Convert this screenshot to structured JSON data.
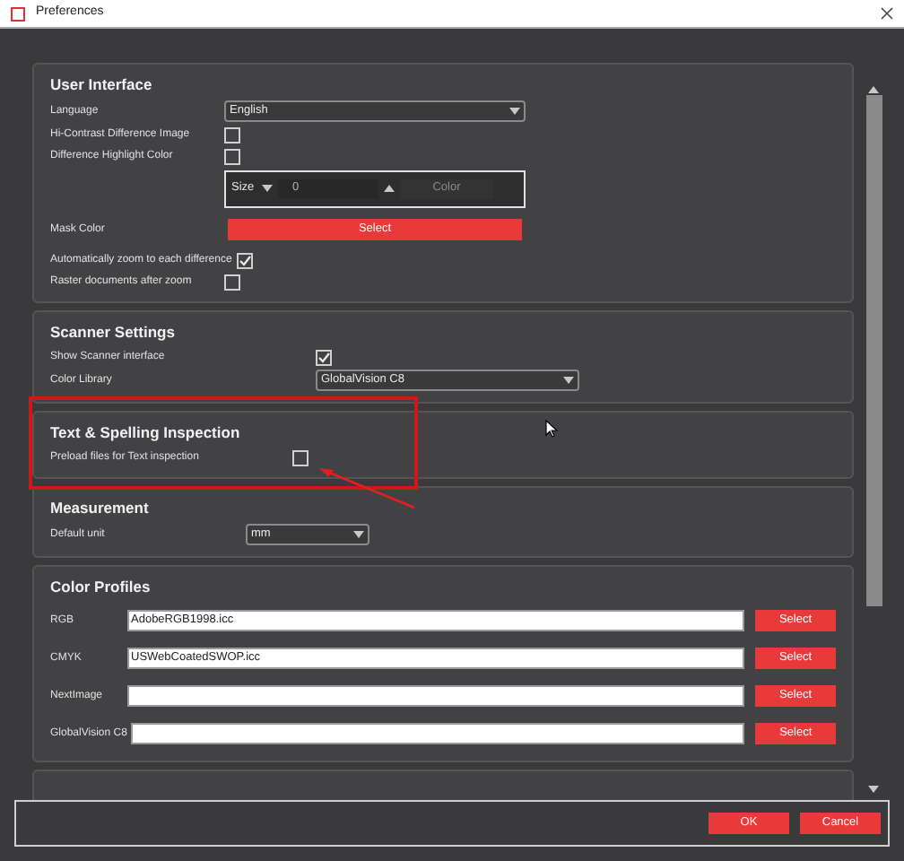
{
  "window": {
    "title": "Preferences"
  },
  "sections": [
    {
      "title": "User Interface",
      "rows": [
        {
          "kind": "dropdown",
          "label": "Language",
          "value": "English"
        },
        {
          "kind": "checkbox",
          "label": "Hi-Contrast Difference Image",
          "checked": false
        },
        {
          "kind": "checkbox",
          "label": "Difference Highlight Color",
          "checked": false
        },
        {
          "kind": "size_color",
          "size_label": "Size",
          "value": "0",
          "color_label": "Color"
        },
        {
          "kind": "button",
          "label": "Mask Color",
          "button": "Select"
        },
        {
          "kind": "checkbox",
          "label": "Automatically zoom to each difference",
          "checked": true
        },
        {
          "kind": "checkbox",
          "label": "Raster documents after zoom",
          "checked": false
        }
      ]
    },
    {
      "title": "Scanner Settings",
      "rows": [
        {
          "kind": "checkbox",
          "label": "Show Scanner interface",
          "checked": true
        },
        {
          "kind": "dropdown",
          "label": "Color Library",
          "value": "GlobalVision C8"
        }
      ]
    },
    {
      "title": "Text & Spelling Inspection",
      "rows": [
        {
          "kind": "checkbox",
          "label": "Preload files for Text inspection",
          "checked": false
        }
      ]
    },
    {
      "title": "Measurement",
      "rows": [
        {
          "kind": "dropdown",
          "label": "Default unit",
          "value": "mm"
        }
      ]
    },
    {
      "title": "Color Profiles",
      "rows": [
        {
          "kind": "field_button",
          "label": "RGB",
          "value": "AdobeRGB1998.icc",
          "button": "Select"
        },
        {
          "kind": "field_button",
          "label": "CMYK",
          "value": "USWebCoatedSWOP.icc",
          "button": "Select"
        },
        {
          "kind": "field_button",
          "label": "NextImage",
          "value": "",
          "button": "Select"
        },
        {
          "kind": "field_button",
          "label": "GlobalVision C8",
          "value": "",
          "button": "Select"
        }
      ]
    }
  ],
  "buttons": [
    "OK",
    "Cancel"
  ]
}
